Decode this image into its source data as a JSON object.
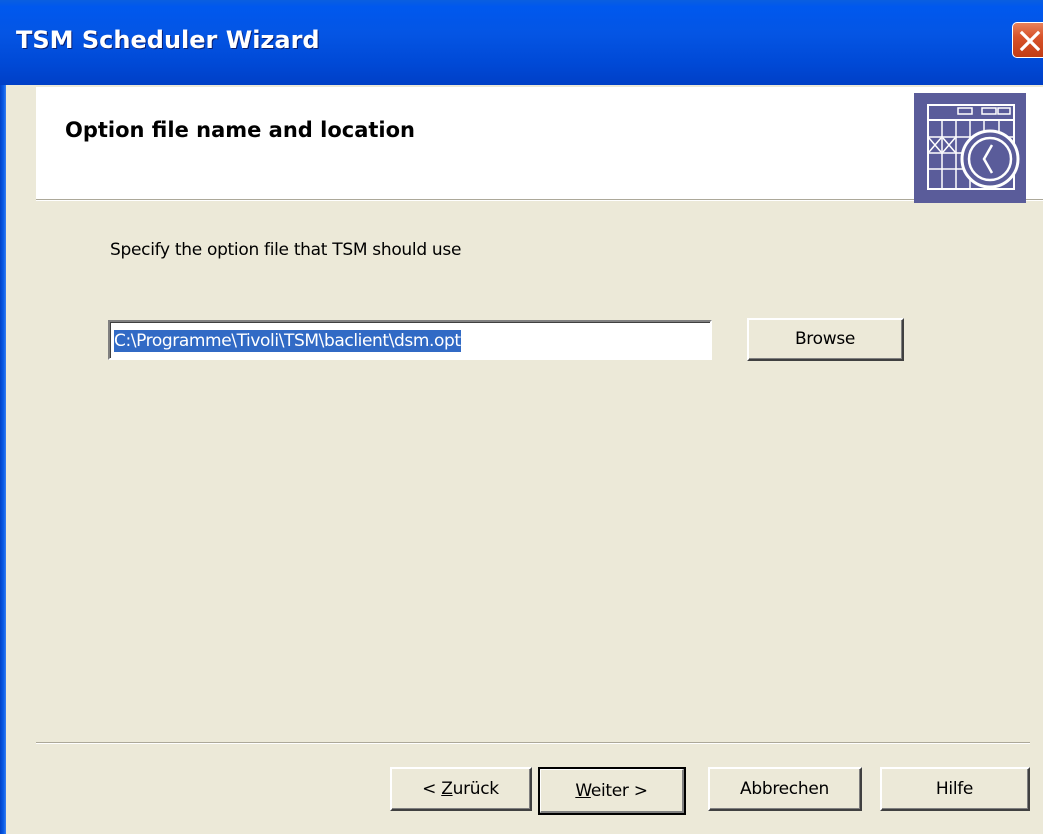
{
  "window": {
    "title": "TSM Scheduler Wizard"
  },
  "header": {
    "title": "Option file name and location",
    "icon": "calendar-clock-icon"
  },
  "content": {
    "instruction": "Specify the option file that TSM should use",
    "option_file_path": "C:\\Programme\\Tivoli\\TSM\\baclient\\dsm.opt",
    "browse_label": "Browse"
  },
  "footer": {
    "back_prefix": "< ",
    "back_accel": "Z",
    "back_rest": "urück",
    "next_accel": "W",
    "next_rest": "eiter >",
    "cancel_label": "Abbrechen",
    "help_label": "Hilfe"
  },
  "colors": {
    "titlebar": "#0055e5",
    "close_button": "#d8532a",
    "dialog_background": "#ece9d8",
    "selection": "#316ac5",
    "icon_tint": "#5a5c9a"
  }
}
